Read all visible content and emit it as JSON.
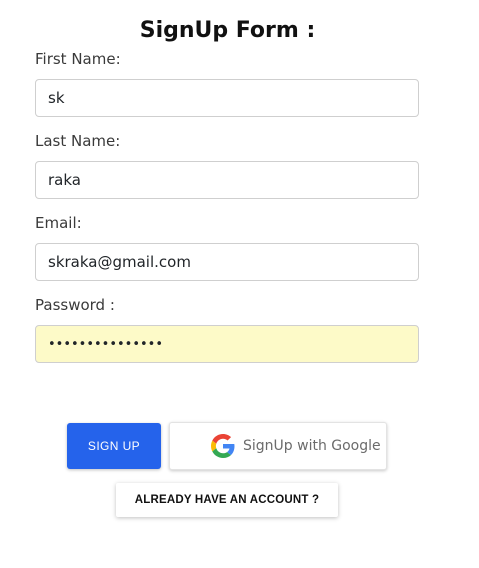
{
  "form": {
    "title": "SignUp Form :",
    "fields": {
      "first_name": {
        "label": "First Name:",
        "value": "sk"
      },
      "last_name": {
        "label": "Last Name:",
        "value": "raka"
      },
      "email": {
        "label": "Email:",
        "value": "skraka@gmail.com"
      },
      "password": {
        "label": "Password :",
        "value": "•••••••••••••••"
      }
    },
    "buttons": {
      "signup": "SIGN UP",
      "google": "SignUp with Google",
      "already_account": "ALREADY HAVE AN ACCOUNT ?"
    }
  },
  "colors": {
    "primary": "#2563eb",
    "autofill_bg": "#fdfac8",
    "google_blue": "#4285F4",
    "google_red": "#EA4335",
    "google_yellow": "#FBBC05",
    "google_green": "#34A853"
  },
  "icons": {
    "google": "google-g-icon"
  }
}
